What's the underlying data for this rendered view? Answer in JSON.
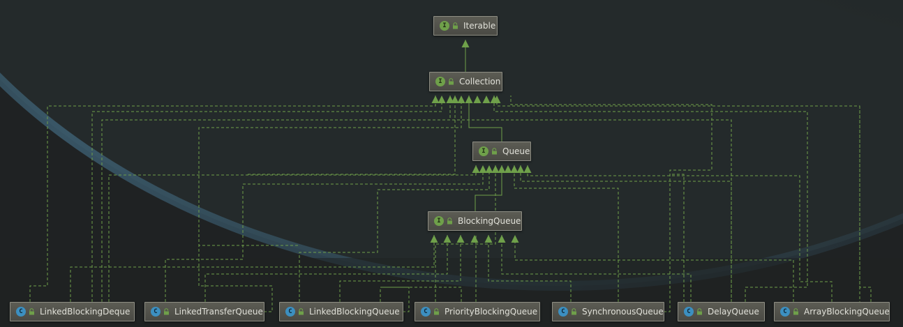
{
  "diagram": {
    "nodes": [
      {
        "id": "iterable",
        "kind": "interface",
        "kind_letter": "I",
        "label": "Iterable"
      },
      {
        "id": "collection",
        "kind": "interface",
        "kind_letter": "I",
        "label": "Collection"
      },
      {
        "id": "queue",
        "kind": "interface",
        "kind_letter": "I",
        "label": "Queue"
      },
      {
        "id": "blockingqueue",
        "kind": "interface",
        "kind_letter": "I",
        "label": "BlockingQueue"
      },
      {
        "id": "linkedblockingdeque",
        "kind": "class",
        "kind_letter": "C",
        "label": "LinkedBlockingDeque"
      },
      {
        "id": "linkedtransferqueue",
        "kind": "class",
        "kind_letter": "C",
        "label": "LinkedTransferQueue"
      },
      {
        "id": "linkedblockingqueue",
        "kind": "class",
        "kind_letter": "C",
        "label": "LinkedBlockingQueue"
      },
      {
        "id": "priorityblockingqueue",
        "kind": "class",
        "kind_letter": "C",
        "label": "PriorityBlockingQueue"
      },
      {
        "id": "synchronousqueue",
        "kind": "class",
        "kind_letter": "C",
        "label": "SynchronousQueue"
      },
      {
        "id": "delayqueue",
        "kind": "class",
        "kind_letter": "C",
        "label": "DelayQueue"
      },
      {
        "id": "arrayblockingqueue",
        "kind": "class",
        "kind_letter": "C",
        "label": "ArrayBlockingQueue"
      }
    ],
    "edges": [
      {
        "from": "collection",
        "to": "iterable",
        "style": "extends"
      },
      {
        "from": "queue",
        "to": "collection",
        "style": "extends"
      },
      {
        "from": "blockingqueue",
        "to": "queue",
        "style": "extends"
      },
      {
        "from": "linkedblockingdeque",
        "to": "blockingqueue",
        "style": "implements"
      },
      {
        "from": "linkedtransferqueue",
        "to": "blockingqueue",
        "style": "implements"
      },
      {
        "from": "linkedblockingqueue",
        "to": "blockingqueue",
        "style": "implements"
      },
      {
        "from": "priorityblockingqueue",
        "to": "blockingqueue",
        "style": "implements"
      },
      {
        "from": "synchronousqueue",
        "to": "blockingqueue",
        "style": "implements"
      },
      {
        "from": "delayqueue",
        "to": "blockingqueue",
        "style": "implements"
      },
      {
        "from": "arrayblockingqueue",
        "to": "blockingqueue",
        "style": "implements"
      },
      {
        "from": "linkedblockingdeque",
        "to": "queue",
        "style": "implements"
      },
      {
        "from": "linkedtransferqueue",
        "to": "queue",
        "style": "implements"
      },
      {
        "from": "linkedblockingqueue",
        "to": "queue",
        "style": "implements"
      },
      {
        "from": "priorityblockingqueue",
        "to": "queue",
        "style": "implements"
      },
      {
        "from": "synchronousqueue",
        "to": "queue",
        "style": "implements"
      },
      {
        "from": "delayqueue",
        "to": "queue",
        "style": "implements"
      },
      {
        "from": "arrayblockingqueue",
        "to": "queue",
        "style": "implements"
      },
      {
        "from": "linkedblockingdeque",
        "to": "collection",
        "style": "implements"
      },
      {
        "from": "linkedtransferqueue",
        "to": "collection",
        "style": "implements"
      },
      {
        "from": "linkedblockingqueue",
        "to": "collection",
        "style": "implements"
      },
      {
        "from": "priorityblockingqueue",
        "to": "collection",
        "style": "implements"
      },
      {
        "from": "synchronousqueue",
        "to": "collection",
        "style": "implements"
      },
      {
        "from": "delayqueue",
        "to": "collection",
        "style": "implements"
      },
      {
        "from": "arrayblockingqueue",
        "to": "collection",
        "style": "implements"
      }
    ]
  },
  "colors": {
    "edge": "#6fa04a",
    "interface_badge": "#6fa04a",
    "class_badge": "#3c8fc0",
    "lock": "#6fa04a",
    "node_text": "#e0e0d8"
  }
}
